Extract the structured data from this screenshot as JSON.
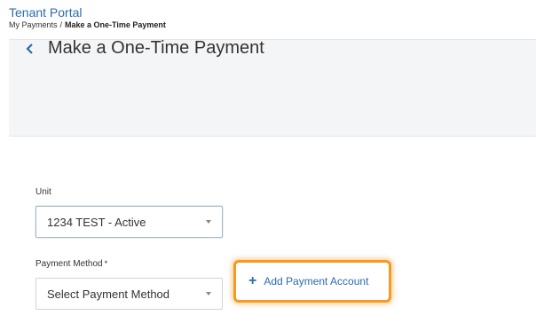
{
  "header": {
    "portal_title": "Tenant Portal",
    "breadcrumb": {
      "parent": "My Payments",
      "separator": "/",
      "current": "Make a One-Time Payment"
    }
  },
  "page": {
    "title": "Make a One-Time Payment",
    "back_icon": "chevron-left-icon"
  },
  "form": {
    "unit": {
      "label": "Unit",
      "value": "1234 TEST - Active"
    },
    "payment_method": {
      "label": "Payment Method",
      "required_mark": "*",
      "value": "Select Payment Method"
    },
    "add_account": {
      "icon": "plus-icon",
      "label": "Add Payment Account"
    }
  },
  "colors": {
    "link": "#2b6cb0",
    "highlight": "#f59a23",
    "title_bar": "#f4f5f7"
  }
}
